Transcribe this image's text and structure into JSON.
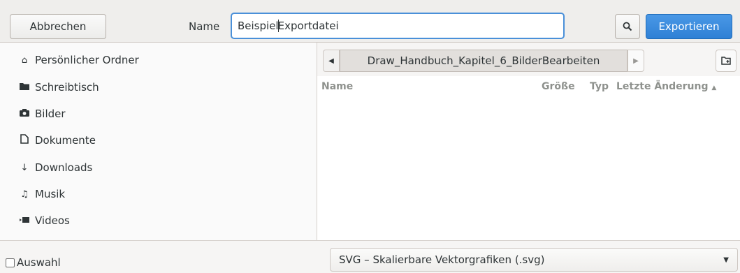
{
  "header": {
    "cancel_label": "Abbrechen",
    "name_label": "Name",
    "filename_before_caret": "Beispiel",
    "filename_after_caret": "Exportdatei",
    "export_label": "Exportieren"
  },
  "sidebar": {
    "items": [
      {
        "label": "Persönlicher Ordner",
        "icon": "home-icon"
      },
      {
        "label": "Schreibtisch",
        "icon": "folder-icon"
      },
      {
        "label": "Bilder",
        "icon": "camera-icon"
      },
      {
        "label": "Dokumente",
        "icon": "document-icon"
      },
      {
        "label": "Downloads",
        "icon": "download-icon"
      },
      {
        "label": "Musik",
        "icon": "music-icon"
      },
      {
        "label": "Videos",
        "icon": "video-icon"
      }
    ]
  },
  "pathbar": {
    "crumb": "Draw_Handbuch_Kapitel_6_BilderBearbeiten"
  },
  "columns": {
    "name": "Name",
    "size": "Größe",
    "type": "Typ",
    "modified": "Letzte Änderung"
  },
  "footer": {
    "selection_label": "Auswahl",
    "filter_value": "SVG – Skalierbare Vektorgrafiken (.svg)"
  },
  "colors": {
    "accent": "#3584e4",
    "focus": "#4a90d9"
  }
}
